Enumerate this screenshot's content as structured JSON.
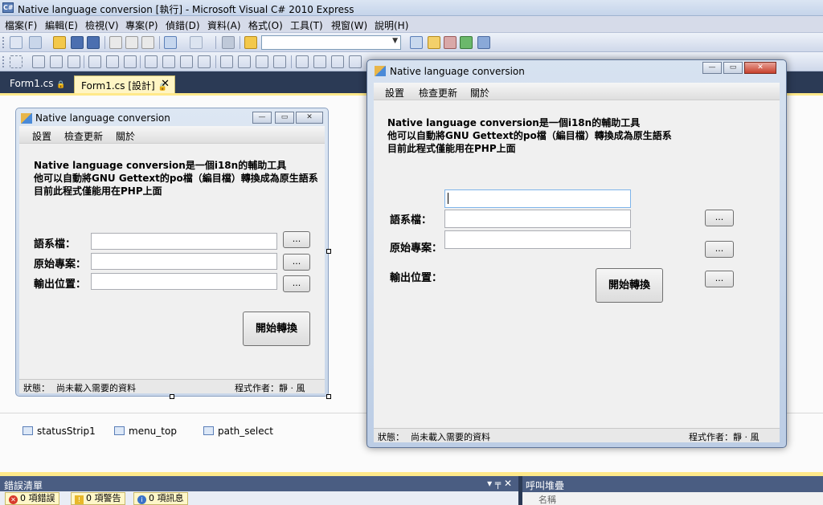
{
  "ide": {
    "title": "Native language conversion [執行] - Microsoft Visual C# 2010 Express",
    "logo": "C#",
    "menu": [
      "檔案(F)",
      "編輯(E)",
      "檢視(V)",
      "專案(P)",
      "偵錯(D)",
      "資料(A)",
      "格式(O)",
      "工具(T)",
      "視窗(W)",
      "說明(H)"
    ],
    "tabs": [
      {
        "label": "Form1.cs",
        "active": false
      },
      {
        "label": "Form1.cs [設計]",
        "active": true
      }
    ],
    "tab_close": "✕",
    "tray": [
      "statusStrip1",
      "menu_top",
      "path_select"
    ]
  },
  "app": {
    "title": "Native language conversion",
    "menu": [
      "設置",
      "檢查更新",
      "關於"
    ],
    "description": [
      "Native language conversion是一個i18n的輔助工具",
      "他可以自動將GNU Gettext的po檔（編目檔）轉換成為原生語系",
      "目前此程式僅能用在PHP上面"
    ],
    "labels": {
      "lang_file": "語系檔：",
      "source_project": "原始專案：",
      "output_location": "輸出位置："
    },
    "browse_label": "...",
    "start_button": "開始轉換",
    "status": {
      "state_label": "狀態：",
      "state_value": "尚未載入需要的資料",
      "author": "程式作者：靜 · 風"
    }
  },
  "panels": {
    "errors": {
      "title": "錯誤清單",
      "pin": "▾ ╤ ✕",
      "errors_count": "0 項錯誤",
      "warnings_count": "0 項警告",
      "messages_count": "0 項訊息"
    },
    "callstack": {
      "title": "呼叫堆疊",
      "column_name": "名稱"
    }
  },
  "colors": {
    "ide_bg": "#2b3a55",
    "tab_active": "#fff5c4",
    "designer_border": "#ffe98a"
  }
}
